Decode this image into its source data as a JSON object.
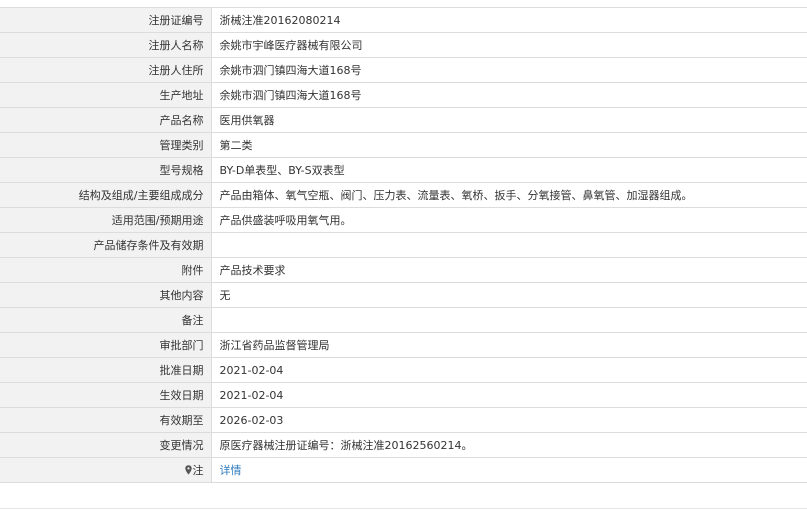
{
  "rows": [
    {
      "label": "注册证编号",
      "value": "浙械注准20162080214"
    },
    {
      "label": "注册人名称",
      "value": "余姚市宇峰医疗器械有限公司"
    },
    {
      "label": "注册人住所",
      "value": "余姚市泗门镇四海大道168号"
    },
    {
      "label": "生产地址",
      "value": "余姚市泗门镇四海大道168号"
    },
    {
      "label": "产品名称",
      "value": "医用供氧器"
    },
    {
      "label": "管理类别",
      "value": "第二类"
    },
    {
      "label": "型号规格",
      "value": "BY-D单表型、BY-S双表型"
    },
    {
      "label": "结构及组成/主要组成成分",
      "value": "产品由箱体、氧气空瓶、阀门、压力表、流量表、氧桥、扳手、分氧接管、鼻氧管、加湿器组成。"
    },
    {
      "label": "适用范围/预期用途",
      "value": "产品供盛装呼吸用氧气用。"
    },
    {
      "label": "产品储存条件及有效期",
      "value": ""
    },
    {
      "label": "附件",
      "value": "产品技术要求"
    },
    {
      "label": "其他内容",
      "value": "无"
    },
    {
      "label": "备注",
      "value": ""
    },
    {
      "label": "审批部门",
      "value": "浙江省药品监督管理局"
    },
    {
      "label": "批准日期",
      "value": "2021-02-04"
    },
    {
      "label": "生效日期",
      "value": "2021-02-04"
    },
    {
      "label": "有效期至",
      "value": "2026-02-03"
    },
    {
      "label": "变更情况",
      "value": "原医疗器械注册证编号：浙械注准20162560214。"
    }
  ],
  "note": {
    "icon": "map-pin-icon",
    "label": "注",
    "link_text": "详情"
  },
  "colors": {
    "label_bg": "#f2f2f2",
    "border": "#dcdcdc",
    "link": "#2f7bbf"
  }
}
